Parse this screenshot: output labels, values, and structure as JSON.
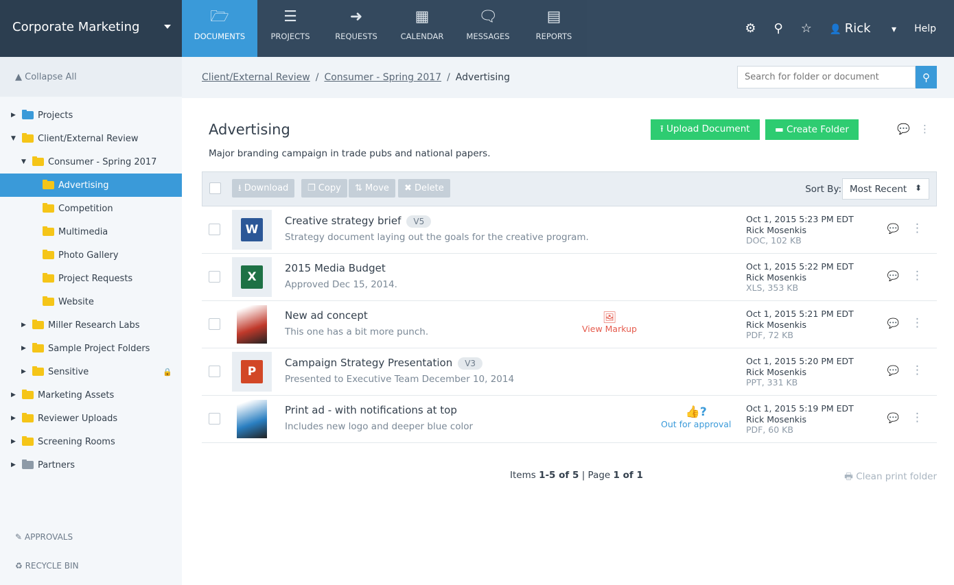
{
  "header": {
    "workspace": "Corporate Marketing",
    "nav": [
      {
        "label": "DOCUMENTS",
        "icon": "🗁"
      },
      {
        "label": "PROJECTS",
        "icon": "☰"
      },
      {
        "label": "REQUESTS",
        "icon": "➜"
      },
      {
        "label": "CALENDAR",
        "icon": "▦"
      },
      {
        "label": "MESSAGES",
        "icon": "🗨"
      },
      {
        "label": "REPORTS",
        "icon": "▤"
      }
    ],
    "user": "Rick",
    "help": "Help"
  },
  "sidebar": {
    "collapse": "▲ Collapse All",
    "tree": [
      {
        "label": "Projects",
        "level": 0,
        "arrow": "▶",
        "color": "#3a9ad9"
      },
      {
        "label": "Client/External Review",
        "level": 0,
        "arrow": "▼",
        "color": "#f5c518"
      },
      {
        "label": "Consumer - Spring 2017",
        "level": 1,
        "arrow": "▼",
        "color": "#f5c518"
      },
      {
        "label": "Advertising",
        "level": 2,
        "arrow": "",
        "color": "#f5c518",
        "selected": true
      },
      {
        "label": "Competition",
        "level": 2,
        "arrow": "",
        "color": "#f5c518"
      },
      {
        "label": "Multimedia",
        "level": 2,
        "arrow": "",
        "color": "#f5c518"
      },
      {
        "label": "Photo Gallery",
        "level": 2,
        "arrow": "",
        "color": "#f5c518"
      },
      {
        "label": "Project Requests",
        "level": 2,
        "arrow": "",
        "color": "#f5c518"
      },
      {
        "label": "Website",
        "level": 2,
        "arrow": "",
        "color": "#f5c518"
      },
      {
        "label": "Miller Research Labs",
        "level": 1,
        "arrow": "▶",
        "color": "#f5c518"
      },
      {
        "label": "Sample Project Folders",
        "level": 1,
        "arrow": "▶",
        "color": "#f5c518"
      },
      {
        "label": "Sensitive",
        "level": 1,
        "arrow": "▶",
        "color": "#f5c518",
        "locked": true
      },
      {
        "label": "Marketing Assets",
        "level": 0,
        "arrow": "▶",
        "color": "#f5c518"
      },
      {
        "label": "Reviewer Uploads",
        "level": 0,
        "arrow": "▶",
        "color": "#f5c518"
      },
      {
        "label": "Screening Rooms",
        "level": 0,
        "arrow": "▶",
        "color": "#f5c518"
      },
      {
        "label": "Partners",
        "level": 0,
        "arrow": "▶",
        "color": "#8d9aa7"
      }
    ],
    "approvals": "APPROVALS",
    "recycle": "RECYCLE BIN"
  },
  "breadcrumb": {
    "items": [
      "Client/External Review",
      "Consumer - Spring 2017"
    ],
    "current": "Advertising"
  },
  "search": {
    "placeholder": "Search for folder or document"
  },
  "folder": {
    "title": "Advertising",
    "description": "Major branding campaign in trade pubs and national papers.",
    "upload": "Upload Document",
    "create": "Create Folder"
  },
  "toolbar": {
    "download": "Download",
    "copy": "Copy",
    "move": "Move",
    "delete": "Delete",
    "sort_label": "Sort By:",
    "sort_value": "Most Recent"
  },
  "documents": [
    {
      "title": "Creative strategy brief",
      "version": "V5",
      "desc": "Strategy document laying out the goals for the creative program.",
      "date": "Oct 1, 2015 5:23 PM EDT",
      "owner": "Rick Mosenkis",
      "size": "DOC, 102 KB",
      "type": "word",
      "badge": "W",
      "color": "#2b5797",
      "status": ""
    },
    {
      "title": "2015 Media Budget",
      "version": "",
      "desc": "Approved Dec 15, 2014.",
      "date": "Oct 1, 2015 5:22 PM EDT",
      "owner": "Rick Mosenkis",
      "size": "XLS, 353 KB",
      "type": "excel",
      "badge": "X",
      "color": "#1e7145",
      "status": ""
    },
    {
      "title": "New ad concept",
      "version": "",
      "desc": "This one has a bit more punch.",
      "date": "Oct 1, 2015 5:21 PM EDT",
      "owner": "Rick Mosenkis",
      "size": "PDF, 72 KB",
      "type": "image",
      "badge": "",
      "color": "#c0392b",
      "status": "View Markup",
      "status_kind": "markup"
    },
    {
      "title": "Campaign Strategy Presentation",
      "version": "V3",
      "desc": "Presented to Executive Team December 10, 2014",
      "date": "Oct 1, 2015 5:20 PM EDT",
      "owner": "Rick Mosenkis",
      "size": "PPT, 331 KB",
      "type": "powerpoint",
      "badge": "P",
      "color": "#d24726",
      "status": ""
    },
    {
      "title": "Print ad - with notifications at top",
      "version": "",
      "desc": "Includes new logo and deeper blue color",
      "date": "Oct 1, 2015 5:19 PM EDT",
      "owner": "Rick Mosenkis",
      "size": "PDF, 60 KB",
      "type": "image",
      "badge": "",
      "color": "#2a7fc1",
      "status": "Out for approval",
      "status_kind": "approval"
    }
  ],
  "footer": {
    "items_prefix": "Items ",
    "items_range": "1-5 of 5",
    "page_prefix": " | Page ",
    "page": "1 of 1",
    "clean_print": "Clean print folder"
  }
}
